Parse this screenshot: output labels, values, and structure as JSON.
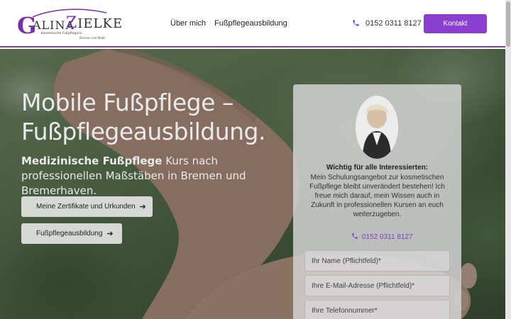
{
  "brand": {
    "logo_initial_g": "G",
    "logo_alina": "ALINA",
    "logo_initial_z": "Z",
    "logo_ielke": "IELKE",
    "tagline": "Kosmetische Fußpflegerin",
    "location": "Bremen und Mobil"
  },
  "nav": {
    "items": [
      {
        "label": "Über mich"
      },
      {
        "label": "Fußpflegeausbildung"
      }
    ],
    "phone": "0152 0311 8127",
    "contact_button": "Kontakt"
  },
  "hero": {
    "title": "Mobile Fußpflege – Fußpflegeausbildung.",
    "subtitle_bold": "Medizinische Fußpflege",
    "subtitle_rest": " Kurs nach professionellen Maßstäben in Bremen und Bremerhaven.",
    "buttons": [
      {
        "label": "Meine Zertifikate und Urkunden"
      },
      {
        "label": "Fußpflegeausbildung"
      }
    ]
  },
  "card": {
    "note_title": "Wichtig für alle Interessierten:",
    "note_body": "Mein Schulungsangebot zur kosmetischen Fußpflege bleibt unverändert bestehen! Ich freue mich darauf, mein Wissen auch in Zukunft in professionellen Kursen an euch weiterzugeben.",
    "phone": "0152 0311 8127",
    "fields": [
      {
        "placeholder": "Ihr Name (Pflichtfeld)*"
      },
      {
        "placeholder": "Ihre E-Mail-Adresse (Pflichtfeld)*"
      },
      {
        "placeholder": "Ihre Telefonnummer*"
      }
    ]
  },
  "colors": {
    "accent": "#8a3fd1",
    "accent_text": "#7b3fbf"
  }
}
